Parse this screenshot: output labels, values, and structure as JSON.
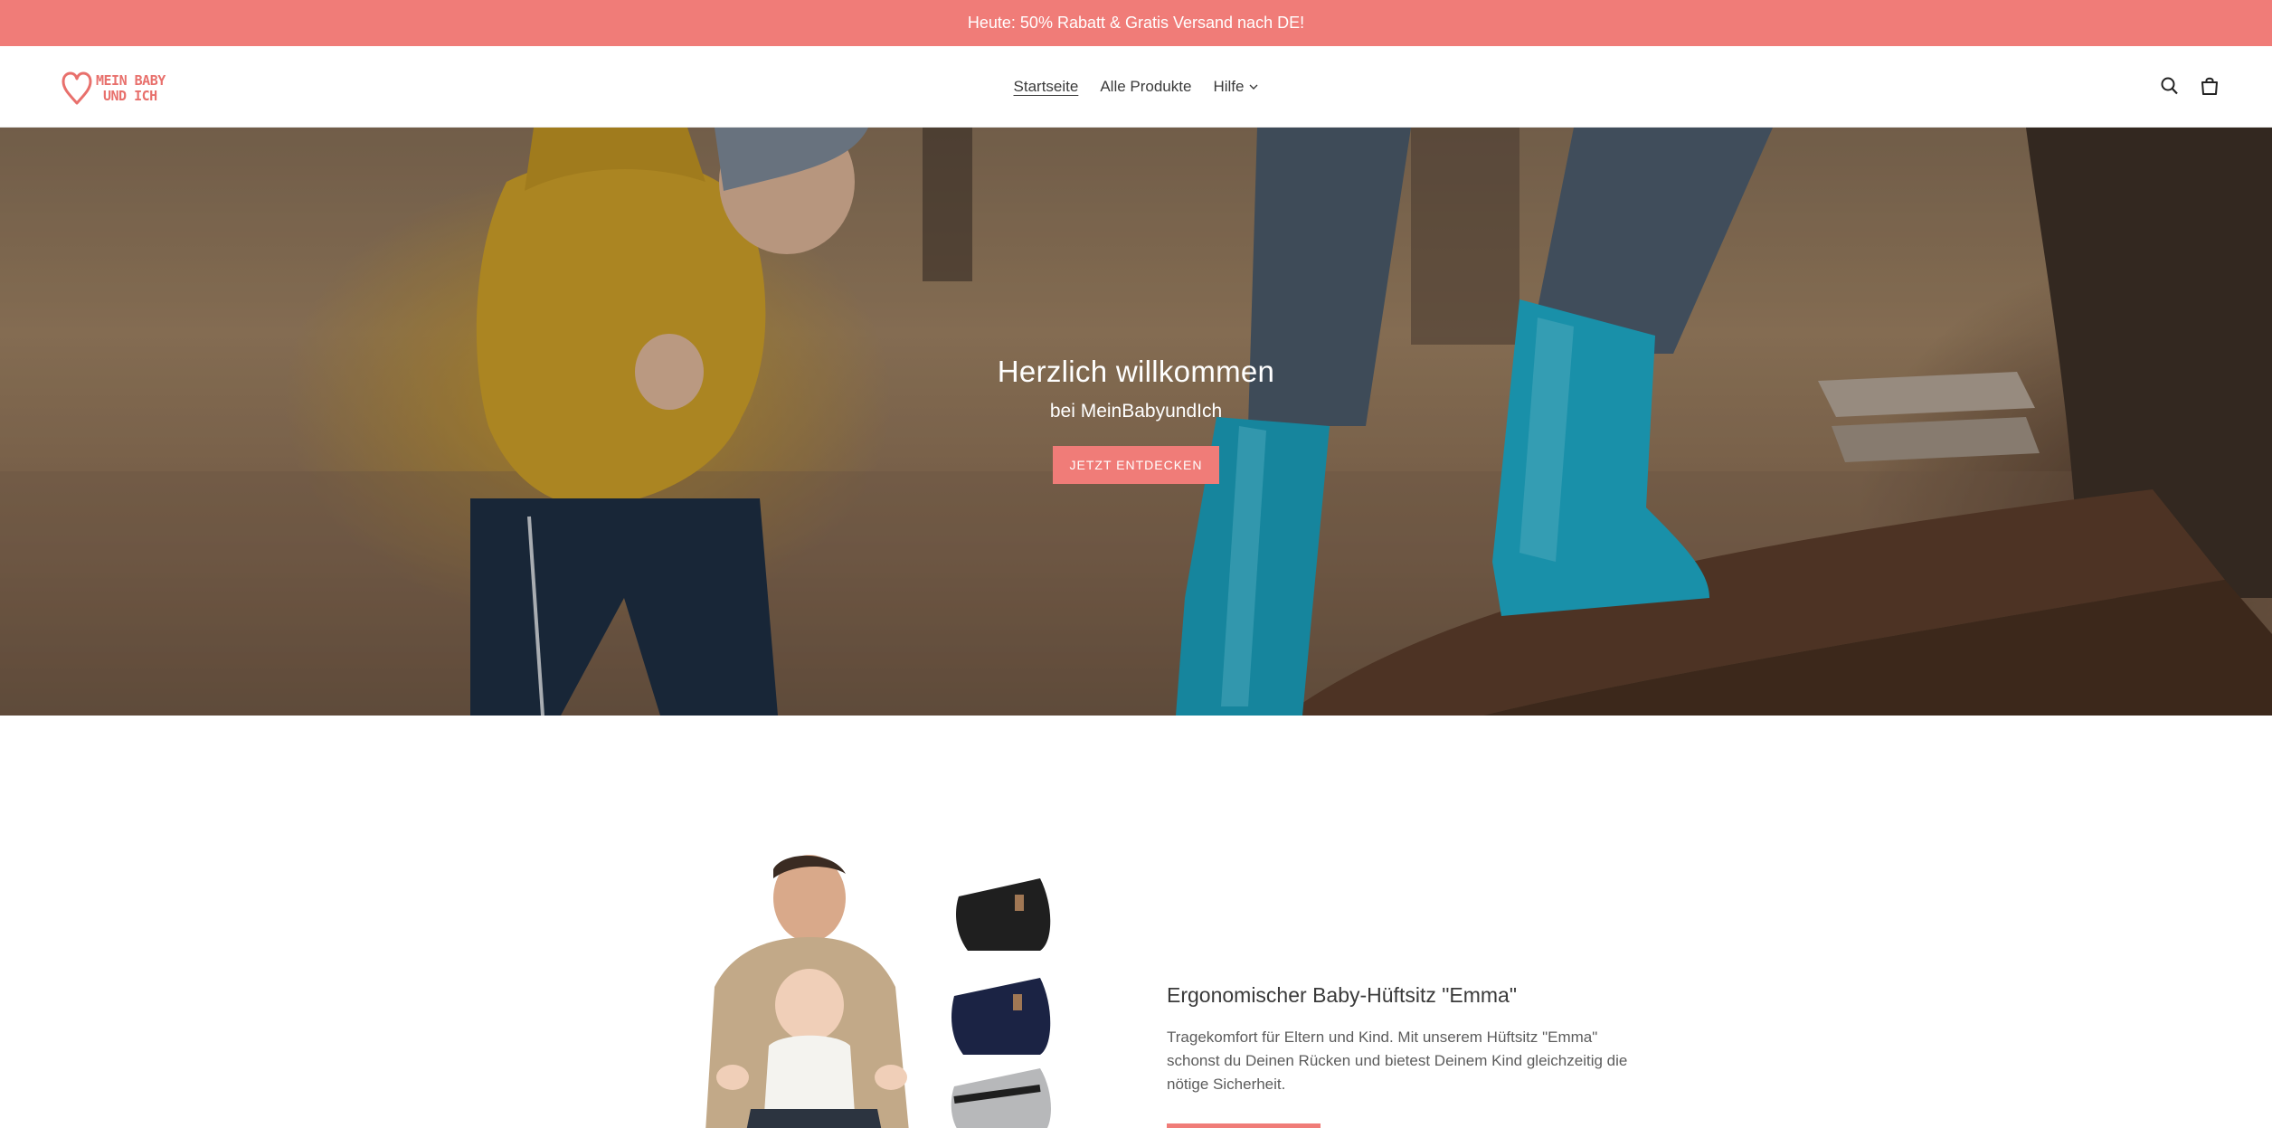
{
  "announcement": {
    "text": "Heute: 50% Rabatt & Gratis Versand nach DE!"
  },
  "header": {
    "logo": {
      "line1": "MEIN BABY",
      "line2": "UND ICH",
      "icon": "heart-icon"
    },
    "nav": [
      {
        "label": "Startseite",
        "active": true
      },
      {
        "label": "Alle Produkte",
        "active": false
      },
      {
        "label": "Hilfe",
        "active": false,
        "dropdown": true
      }
    ],
    "icons": [
      "search-icon",
      "cart-icon"
    ]
  },
  "hero": {
    "title": "Herzlich willkommen",
    "subtitle": "bei MeinBabyundIch",
    "button_label": "JETZT ENTDECKEN"
  },
  "featured_product": {
    "title": "Ergonomischer Baby-Hüftsitz \"Emma\"",
    "description": "Tragekomfort für Eltern und Kind. Mit unserem Hüftsitz \"Emma\" schonst du Deinen Rücken und bietest Deinem Kind gleichzeitig die nötige Sicherheit."
  },
  "colors": {
    "accent": "#f07c78",
    "text": "#3a3a3a"
  }
}
